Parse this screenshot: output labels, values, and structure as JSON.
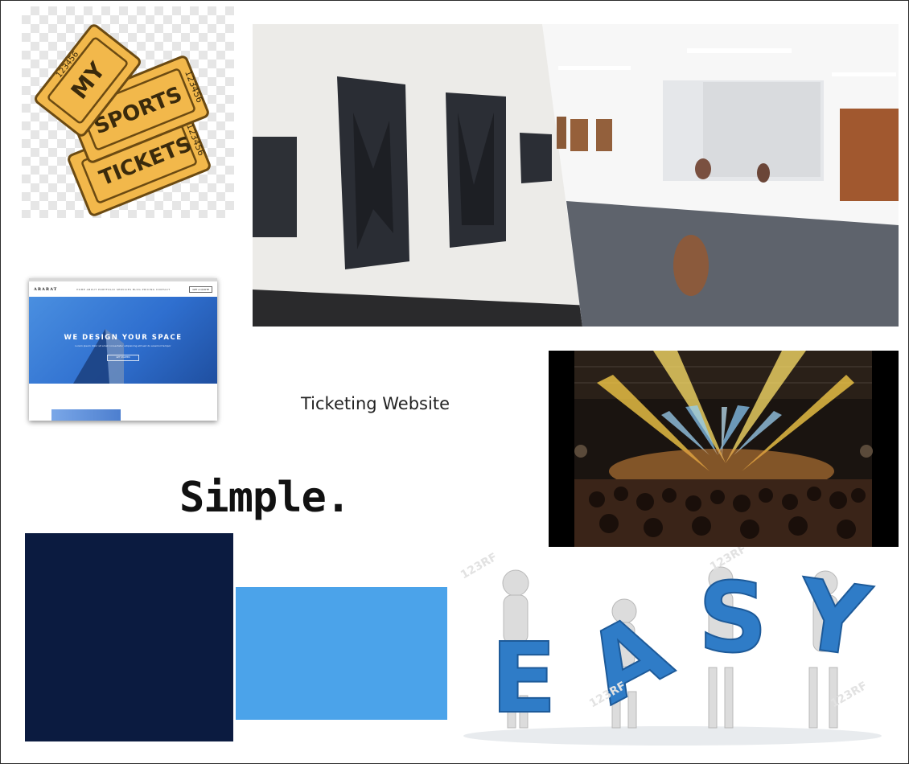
{
  "canvas": {
    "background": "#ffffff"
  },
  "tickets": {
    "lines": [
      "MY",
      "SPORTS",
      "TICKETS"
    ],
    "serial": "123456",
    "color": "#f2b84b"
  },
  "website": {
    "brand": "ARARAT",
    "nav": "HOME   ABOUT   PORTFOLIO   SERVICES   BLOG   PRICING   CONTACT",
    "cta": "GET A QUOTE",
    "hero_title": "WE DESIGN YOUR SPACE",
    "hero_sub": "Lorem ipsum dolor sit amet consectetur adipisicing elit sed do eiusmod tempor",
    "hero_button": "GET STARTED"
  },
  "caption": "Ticketing Website",
  "simple_text": "Simple.",
  "swatches": {
    "navy": "#0b1b40",
    "light_blue": "#4ba3ea"
  },
  "easy": {
    "letters": [
      "E",
      "A",
      "S",
      "Y"
    ],
    "color": "#2f7cc7",
    "watermark": "123RF"
  }
}
